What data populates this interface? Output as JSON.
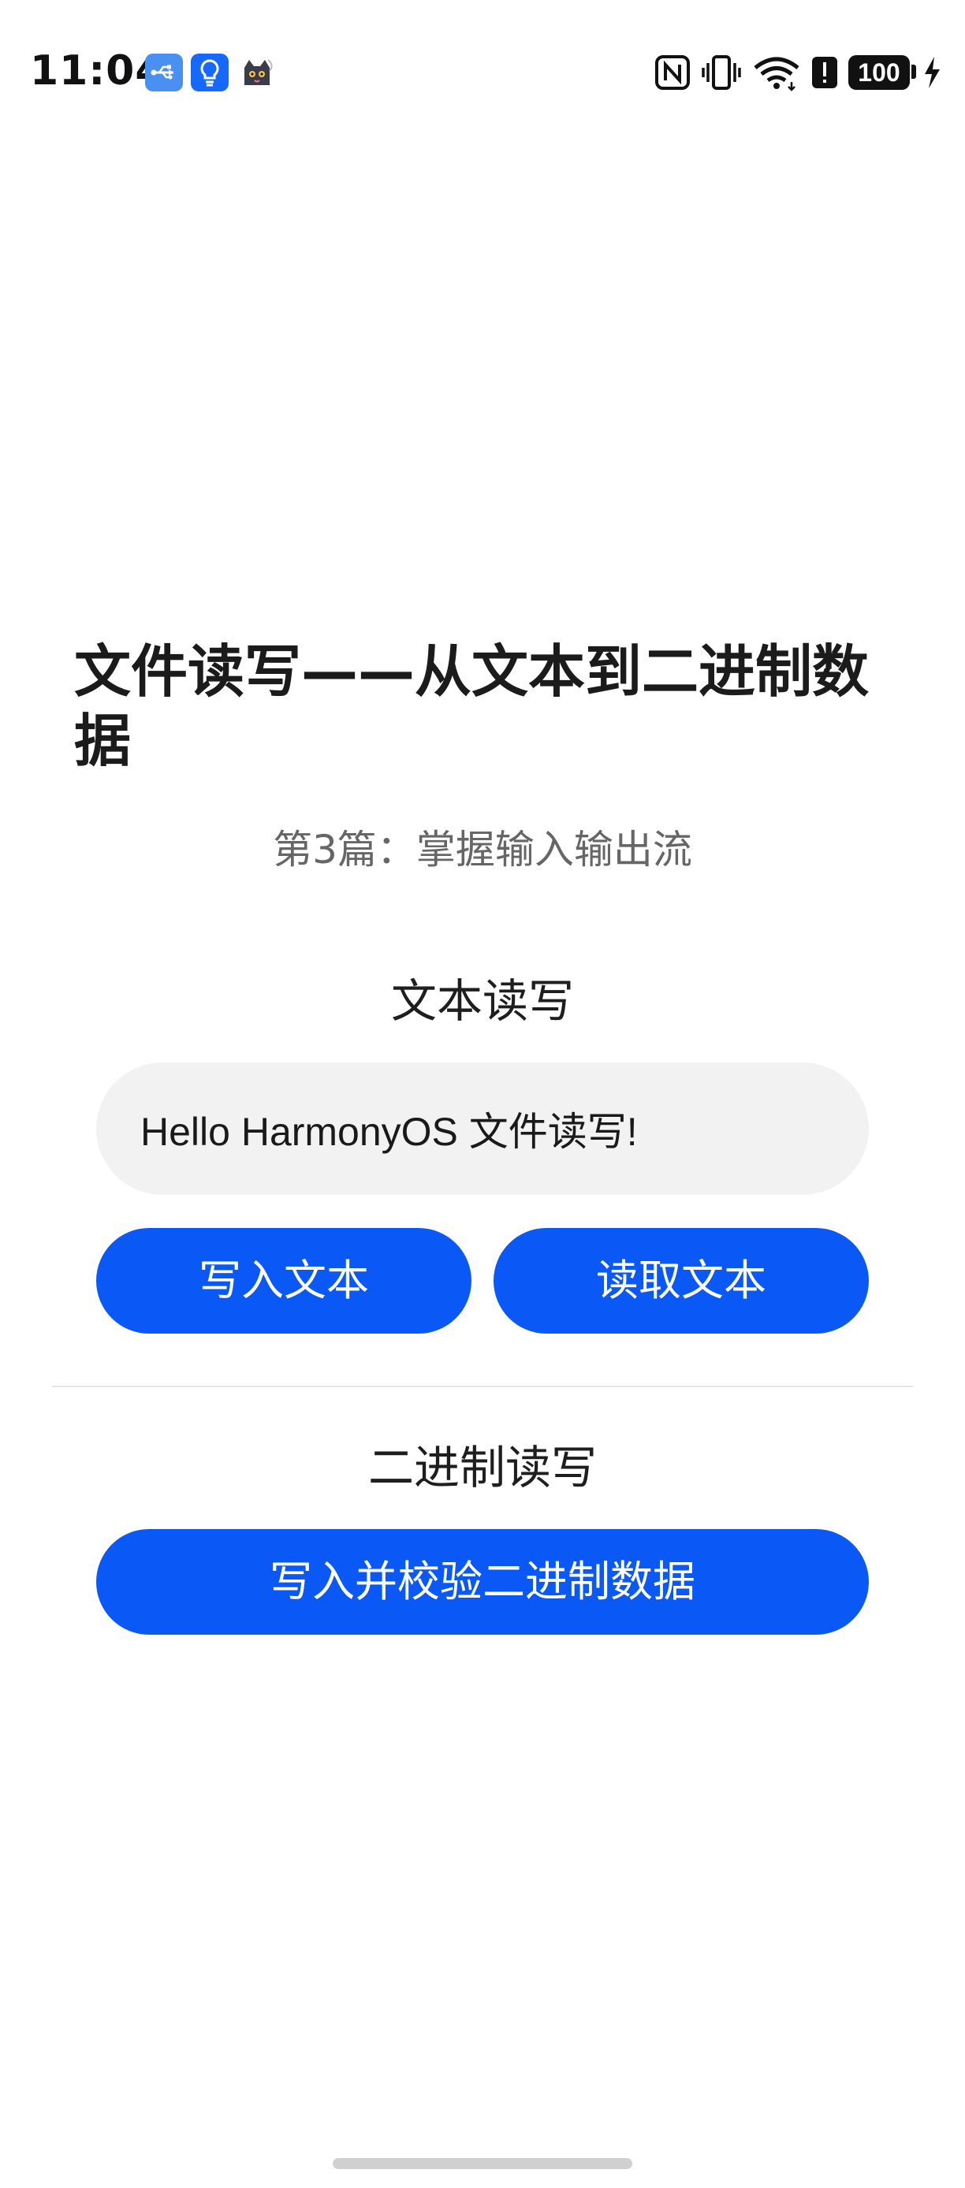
{
  "status_bar": {
    "time": "11:04",
    "notification_icons": [
      "usb-icon",
      "lightbulb-icon",
      "cat-app-icon"
    ],
    "right_icons": [
      "nfc-icon",
      "vibrate-icon",
      "wifi-icon",
      "alert-icon",
      "battery-icon",
      "charging-icon"
    ],
    "battery_level": "100"
  },
  "page": {
    "title": "文件读写——从文本到二进制数据",
    "subtitle": "第3篇：掌握输入输出流"
  },
  "text_section": {
    "heading": "文本读写",
    "input_value": "Hello HarmonyOS 文件读写!",
    "write_button": "写入文本",
    "read_button": "读取文本"
  },
  "binary_section": {
    "heading": "二进制读写",
    "button": "写入并校验二进制数据"
  },
  "colors": {
    "primary_button": "#0a59f7",
    "input_background": "#f2f2f2",
    "subtitle_text": "#666666"
  }
}
